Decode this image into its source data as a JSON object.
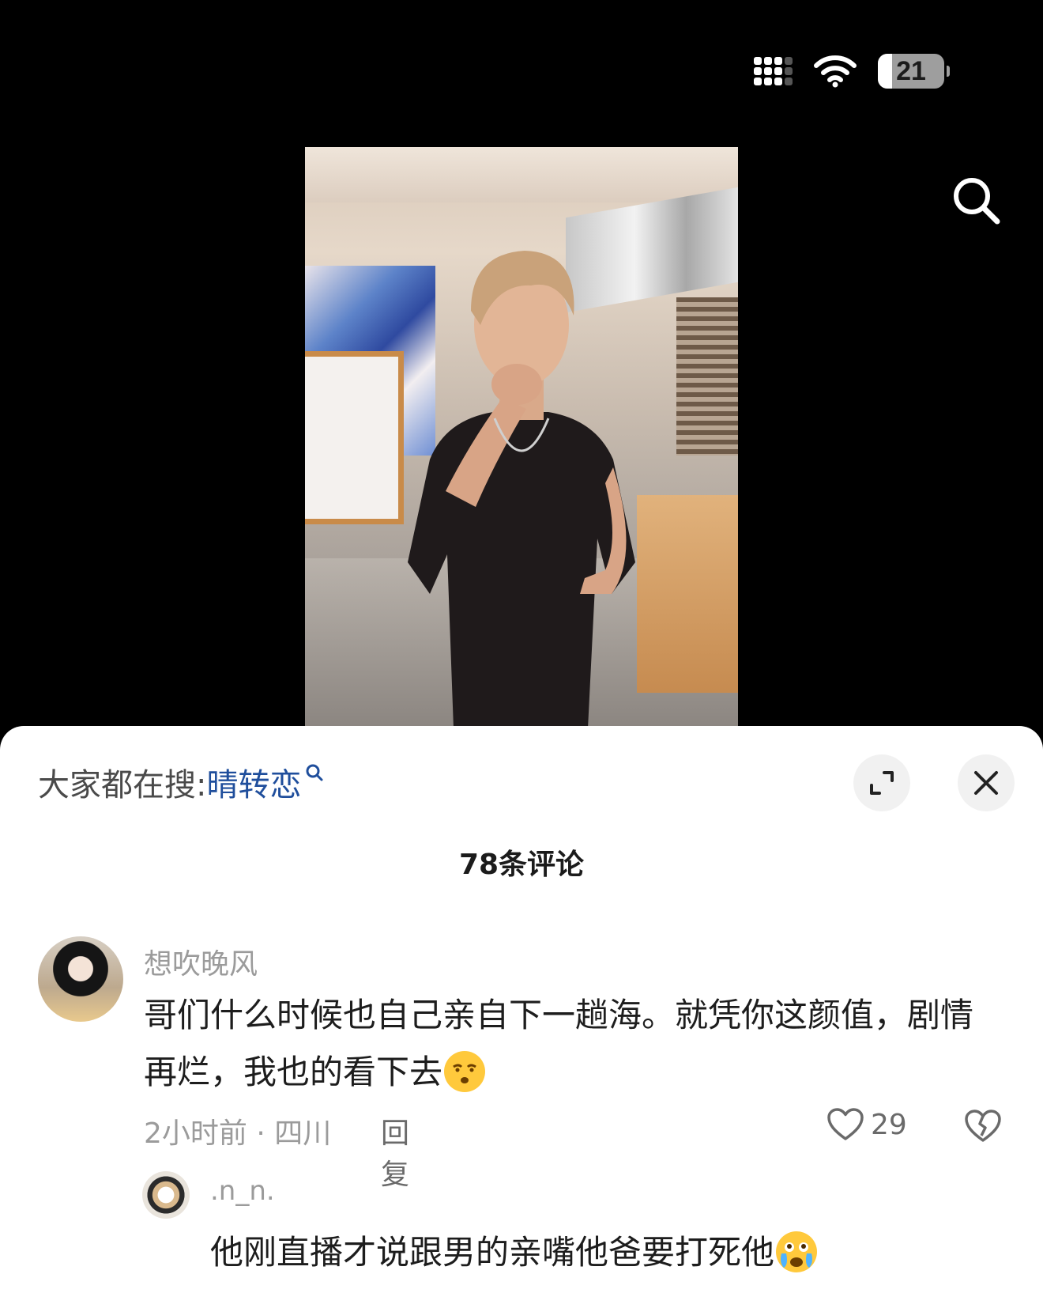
{
  "status_bar": {
    "battery_level": "21",
    "battery_fraction": 0.21,
    "icons": [
      "signal-icon",
      "wifi-icon",
      "battery-icon"
    ]
  },
  "video": {
    "search_icon": "search-icon"
  },
  "sheet": {
    "search_hint_prefix": "大家都在搜:",
    "search_hint_term": "晴转恋",
    "expand_icon": "expand-icon",
    "close_icon": "close-icon",
    "comment_count_label": "78条评论"
  },
  "comments": [
    {
      "username": "想吹晚风",
      "text": "哥们什么时候也自己亲自下一趟海。就凭你这颜值，剧情再烂，我也的看下去",
      "emoji": "smirk-face-emoji",
      "meta": "2小时前 · 四川",
      "reply_label": "回复",
      "likes": "29"
    },
    {
      "username": ".n_n.",
      "text": "他刚直播才说跟男的亲嘴他爸要打死他",
      "emoji": "crying-face-emoji"
    }
  ],
  "colors": {
    "background": "#000000",
    "sheet": "#ffffff",
    "link_blue": "#1f4e9c",
    "muted_text": "#9b9b9b"
  }
}
